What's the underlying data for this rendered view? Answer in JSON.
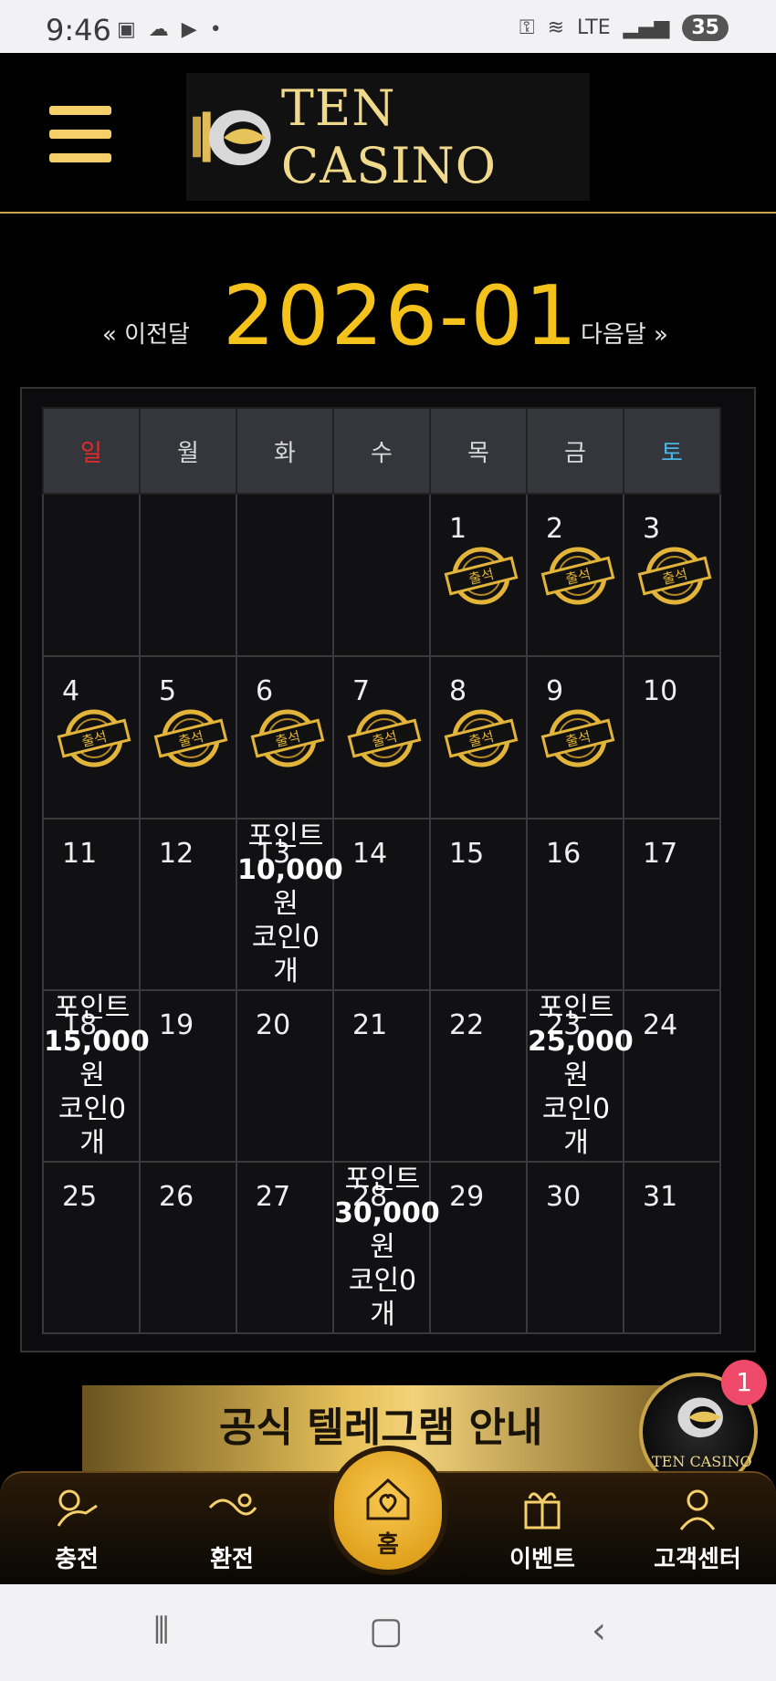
{
  "status_bar": {
    "time": "9:46",
    "battery": "35",
    "network": "LTE"
  },
  "header": {
    "brand": "TEN CASINO",
    "menu_icon": "hamburger-menu-icon"
  },
  "calendar": {
    "month_title": "2026-01",
    "prev_label": "« 이전달",
    "next_label": "다음달 »",
    "weekdays": [
      "일",
      "월",
      "화",
      "수",
      "목",
      "금",
      "토"
    ],
    "stamp_label": "출석",
    "weeks": [
      [
        {
          "d": ""
        },
        {
          "d": ""
        },
        {
          "d": ""
        },
        {
          "d": ""
        },
        {
          "d": "1",
          "stamp": true
        },
        {
          "d": "2",
          "stamp": true
        },
        {
          "d": "3",
          "stamp": true
        }
      ],
      [
        {
          "d": "4",
          "stamp": true
        },
        {
          "d": "5",
          "stamp": true
        },
        {
          "d": "6",
          "stamp": true
        },
        {
          "d": "7",
          "stamp": true
        },
        {
          "d": "8",
          "stamp": true
        },
        {
          "d": "9",
          "stamp": true
        },
        {
          "d": "10"
        }
      ],
      [
        {
          "d": "11"
        },
        {
          "d": "12"
        },
        {
          "d": "13",
          "note": [
            "포인트",
            "10,000",
            "원",
            "코인0",
            "개"
          ]
        },
        {
          "d": "14"
        },
        {
          "d": "15"
        },
        {
          "d": "16"
        },
        {
          "d": "17"
        }
      ],
      [
        {
          "d": "18",
          "note": [
            "포인트",
            "15,000",
            "원",
            "코인0",
            "개"
          ]
        },
        {
          "d": "19"
        },
        {
          "d": "20"
        },
        {
          "d": "21"
        },
        {
          "d": "22"
        },
        {
          "d": "23",
          "note": [
            "포인트",
            "25,000",
            "원",
            "코인0",
            "개"
          ]
        },
        {
          "d": "24"
        }
      ],
      [
        {
          "d": "25"
        },
        {
          "d": "26"
        },
        {
          "d": "27"
        },
        {
          "d": "28",
          "note": [
            "포인트",
            "30,000",
            "원",
            "코인0",
            "개"
          ]
        },
        {
          "d": "29"
        },
        {
          "d": "30"
        },
        {
          "d": "31"
        }
      ]
    ]
  },
  "banner": {
    "text": "공식 텔레그램 안내"
  },
  "floating": {
    "badge_count": "1",
    "brand": "TEN CASINO"
  },
  "bottom_nav": {
    "items": [
      {
        "label": "충전",
        "icon": "charge-icon"
      },
      {
        "label": "환전",
        "icon": "exchange-icon"
      },
      {
        "label": "홈",
        "icon": "home-heart-icon"
      },
      {
        "label": "이벤트",
        "icon": "gift-icon"
      },
      {
        "label": "고객센터",
        "icon": "support-icon"
      }
    ]
  },
  "colors": {
    "gold": "#f4c21a",
    "sunday": "#e52a2a",
    "saturday": "#49b6e6"
  }
}
